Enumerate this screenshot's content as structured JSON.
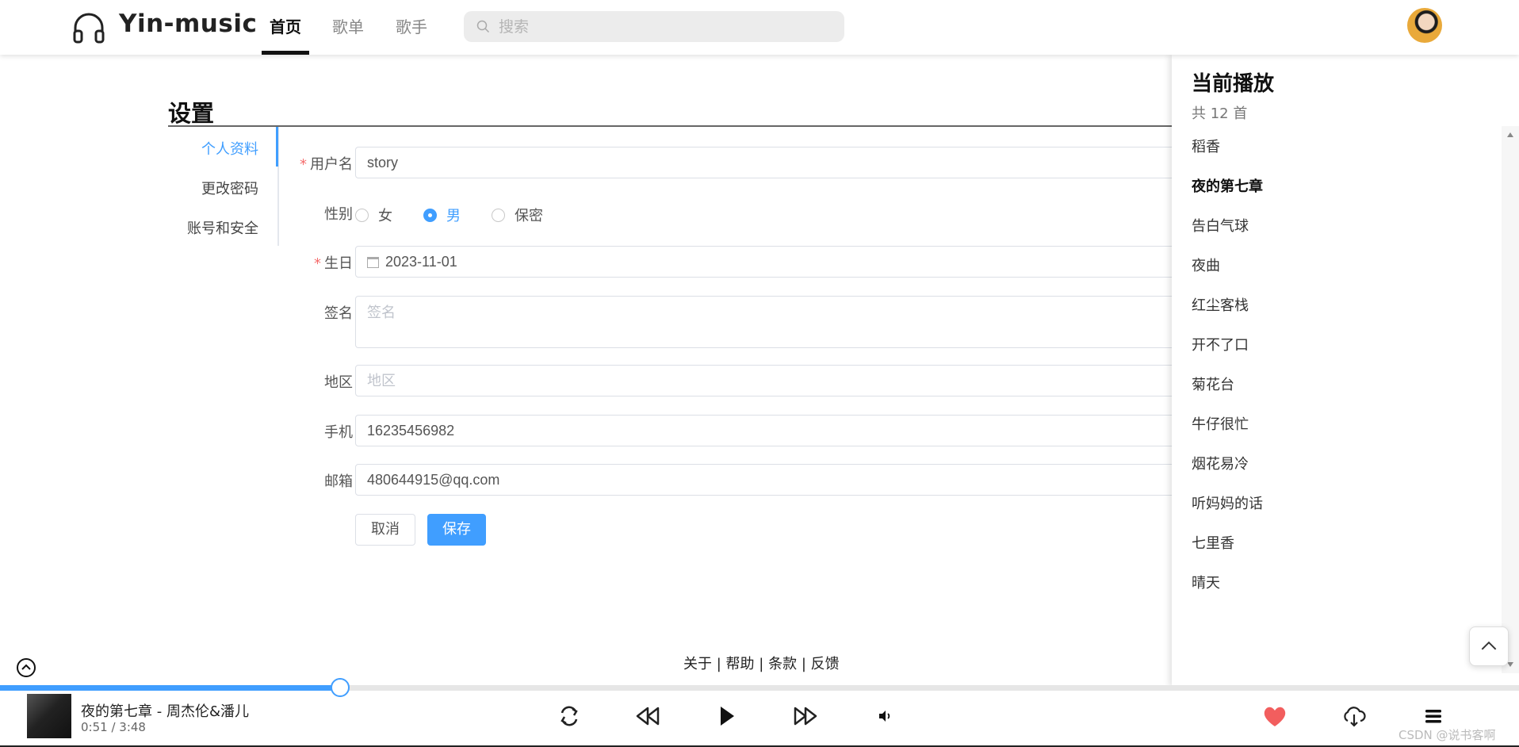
{
  "app": {
    "name": "Yin-music"
  },
  "nav": {
    "items": [
      {
        "label": "首页",
        "active": true
      },
      {
        "label": "歌单",
        "active": false
      },
      {
        "label": "歌手",
        "active": false
      }
    ]
  },
  "search": {
    "placeholder": "搜索",
    "value": ""
  },
  "settings": {
    "title": "设置",
    "menu": [
      "个人资料",
      "更改密码",
      "账号和安全"
    ],
    "form": {
      "username": {
        "label": "用户名",
        "value": "story"
      },
      "gender": {
        "label": "性别",
        "options": [
          "女",
          "男",
          "保密"
        ],
        "selected": "男"
      },
      "birthday": {
        "label": "生日",
        "value": "2023-11-01"
      },
      "signature": {
        "label": "签名",
        "placeholder": "签名",
        "value": ""
      },
      "region": {
        "label": "地区",
        "placeholder": "地区",
        "value": ""
      },
      "phone": {
        "label": "手机",
        "value": "16235456982"
      },
      "email": {
        "label": "邮箱",
        "value": "480644915@qq.com"
      }
    },
    "cancel_label": "取消",
    "save_label": "保存"
  },
  "footer": {
    "links": [
      "关于",
      "帮助",
      "条款",
      "反馈"
    ],
    "separator": "|"
  },
  "playlist": {
    "title": "当前播放",
    "count": "共 12 首",
    "items": [
      "稻香",
      "夜的第七章",
      "告白气球",
      "夜曲",
      "红尘客栈",
      "开不了口",
      "菊花台",
      "牛仔很忙",
      "烟花易冷",
      "听妈妈的话",
      "七里香",
      "晴天"
    ],
    "current_index": 1
  },
  "player": {
    "song": "夜的第七章 - 周杰伦&潘儿",
    "time": "0:51 / 3:48",
    "progress": 0.224,
    "liked": true,
    "icons": [
      "repeat-icon",
      "previous-icon",
      "play-icon",
      "next-icon",
      "volume-icon",
      "heart-icon",
      "download-icon",
      "playlist-menu-icon"
    ],
    "accent": "#409eff",
    "heart_color": "#f25e5e"
  },
  "watermark": "CSDN @说书客啊"
}
